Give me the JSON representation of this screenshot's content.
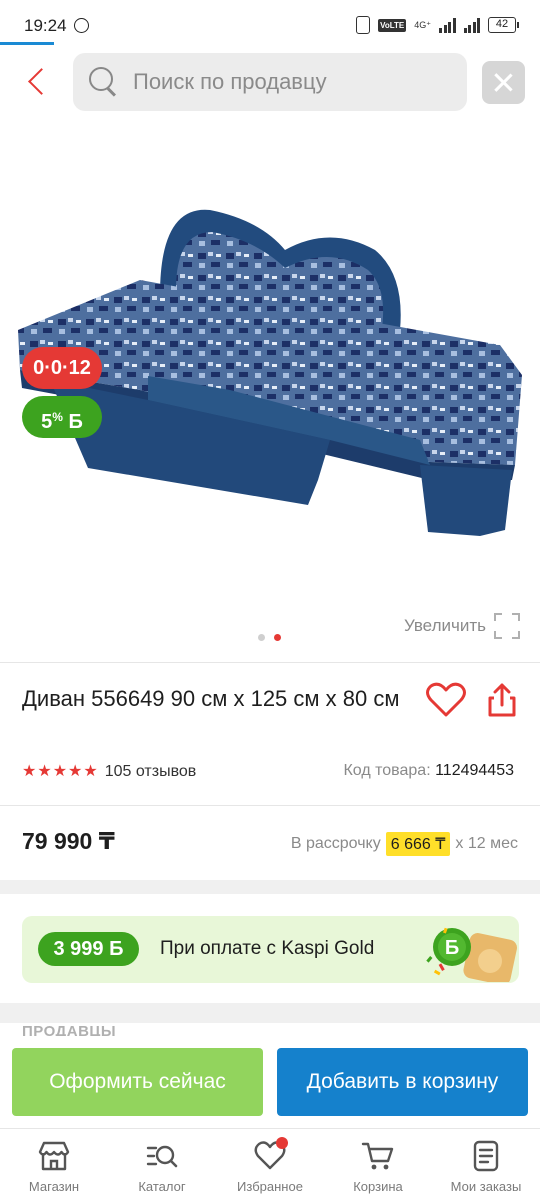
{
  "status_bar": {
    "time": "19:24",
    "volte": "VoLTE",
    "network": "4G⁺",
    "battery": "42"
  },
  "search": {
    "placeholder": "Поиск по продавцу"
  },
  "product": {
    "badges": {
      "installment": "0·0·12",
      "bonus_percent": "5",
      "bonus_unit": "%",
      "bonus_sign": "Б"
    },
    "zoom_label": "Увеличить",
    "title": "Диван 556649 90 см x 125 см x 80 см",
    "rating_stars": 5,
    "reviews": "105 отзывов",
    "sku_label": "Код товара:",
    "sku": "112494453",
    "price": "79 990 ₸",
    "installment_label": "В рассрочку",
    "monthly_payment": "6 666 ₸",
    "installment_term": "x 12 мес"
  },
  "kaspi_gold_banner": {
    "bonus": "3 999 Б",
    "text": "При оплате с Kaspi Gold"
  },
  "sellers_heading": "ПРОДАВЦЫ",
  "actions": {
    "buy_now": "Оформить сейчас",
    "add_to_cart": "Добавить в корзину"
  },
  "bottom_nav": {
    "items": [
      {
        "label": "Магазин",
        "icon": "store-icon"
      },
      {
        "label": "Каталог",
        "icon": "catalog-search-icon"
      },
      {
        "label": "Избранное",
        "icon": "heart-icon"
      },
      {
        "label": "Корзина",
        "icon": "cart-icon"
      },
      {
        "label": "Мои заказы",
        "icon": "orders-icon"
      }
    ]
  },
  "colors": {
    "accent_red": "#e53935",
    "bonus_green": "#3da31f",
    "buy_now_green": "#92d45d",
    "cart_blue": "#1581cc",
    "installment_yellow": "#ffdf29"
  }
}
